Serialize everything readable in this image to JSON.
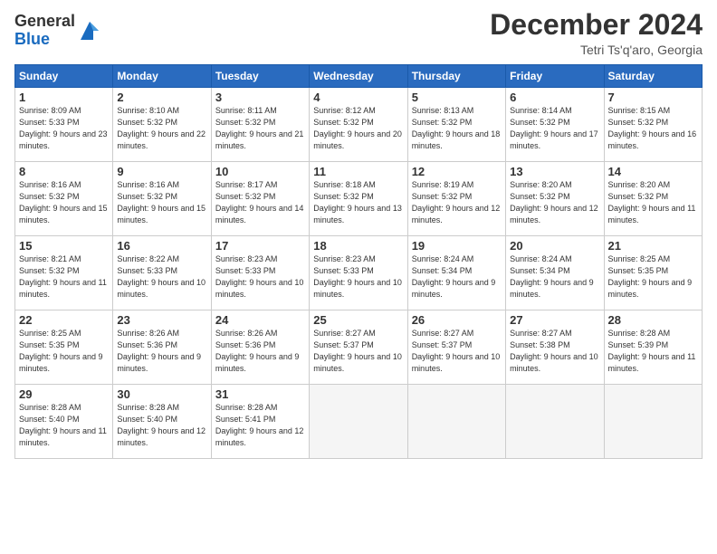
{
  "header": {
    "logo_general": "General",
    "logo_blue": "Blue",
    "month_title": "December 2024",
    "location": "Tetri Ts'q'aro, Georgia"
  },
  "weekdays": [
    "Sunday",
    "Monday",
    "Tuesday",
    "Wednesday",
    "Thursday",
    "Friday",
    "Saturday"
  ],
  "weeks": [
    [
      {
        "day": "1",
        "sunrise": "8:09 AM",
        "sunset": "5:33 PM",
        "daylight": "9 hours and 23 minutes."
      },
      {
        "day": "2",
        "sunrise": "8:10 AM",
        "sunset": "5:32 PM",
        "daylight": "9 hours and 22 minutes."
      },
      {
        "day": "3",
        "sunrise": "8:11 AM",
        "sunset": "5:32 PM",
        "daylight": "9 hours and 21 minutes."
      },
      {
        "day": "4",
        "sunrise": "8:12 AM",
        "sunset": "5:32 PM",
        "daylight": "9 hours and 20 minutes."
      },
      {
        "day": "5",
        "sunrise": "8:13 AM",
        "sunset": "5:32 PM",
        "daylight": "9 hours and 18 minutes."
      },
      {
        "day": "6",
        "sunrise": "8:14 AM",
        "sunset": "5:32 PM",
        "daylight": "9 hours and 17 minutes."
      },
      {
        "day": "7",
        "sunrise": "8:15 AM",
        "sunset": "5:32 PM",
        "daylight": "9 hours and 16 minutes."
      }
    ],
    [
      {
        "day": "8",
        "sunrise": "8:16 AM",
        "sunset": "5:32 PM",
        "daylight": "9 hours and 15 minutes."
      },
      {
        "day": "9",
        "sunrise": "8:16 AM",
        "sunset": "5:32 PM",
        "daylight": "9 hours and 15 minutes."
      },
      {
        "day": "10",
        "sunrise": "8:17 AM",
        "sunset": "5:32 PM",
        "daylight": "9 hours and 14 minutes."
      },
      {
        "day": "11",
        "sunrise": "8:18 AM",
        "sunset": "5:32 PM",
        "daylight": "9 hours and 13 minutes."
      },
      {
        "day": "12",
        "sunrise": "8:19 AM",
        "sunset": "5:32 PM",
        "daylight": "9 hours and 12 minutes."
      },
      {
        "day": "13",
        "sunrise": "8:20 AM",
        "sunset": "5:32 PM",
        "daylight": "9 hours and 12 minutes."
      },
      {
        "day": "14",
        "sunrise": "8:20 AM",
        "sunset": "5:32 PM",
        "daylight": "9 hours and 11 minutes."
      }
    ],
    [
      {
        "day": "15",
        "sunrise": "8:21 AM",
        "sunset": "5:32 PM",
        "daylight": "9 hours and 11 minutes."
      },
      {
        "day": "16",
        "sunrise": "8:22 AM",
        "sunset": "5:33 PM",
        "daylight": "9 hours and 10 minutes."
      },
      {
        "day": "17",
        "sunrise": "8:23 AM",
        "sunset": "5:33 PM",
        "daylight": "9 hours and 10 minutes."
      },
      {
        "day": "18",
        "sunrise": "8:23 AM",
        "sunset": "5:33 PM",
        "daylight": "9 hours and 10 minutes."
      },
      {
        "day": "19",
        "sunrise": "8:24 AM",
        "sunset": "5:34 PM",
        "daylight": "9 hours and 9 minutes."
      },
      {
        "day": "20",
        "sunrise": "8:24 AM",
        "sunset": "5:34 PM",
        "daylight": "9 hours and 9 minutes."
      },
      {
        "day": "21",
        "sunrise": "8:25 AM",
        "sunset": "5:35 PM",
        "daylight": "9 hours and 9 minutes."
      }
    ],
    [
      {
        "day": "22",
        "sunrise": "8:25 AM",
        "sunset": "5:35 PM",
        "daylight": "9 hours and 9 minutes."
      },
      {
        "day": "23",
        "sunrise": "8:26 AM",
        "sunset": "5:36 PM",
        "daylight": "9 hours and 9 minutes."
      },
      {
        "day": "24",
        "sunrise": "8:26 AM",
        "sunset": "5:36 PM",
        "daylight": "9 hours and 9 minutes."
      },
      {
        "day": "25",
        "sunrise": "8:27 AM",
        "sunset": "5:37 PM",
        "daylight": "9 hours and 10 minutes."
      },
      {
        "day": "26",
        "sunrise": "8:27 AM",
        "sunset": "5:37 PM",
        "daylight": "9 hours and 10 minutes."
      },
      {
        "day": "27",
        "sunrise": "8:27 AM",
        "sunset": "5:38 PM",
        "daylight": "9 hours and 10 minutes."
      },
      {
        "day": "28",
        "sunrise": "8:28 AM",
        "sunset": "5:39 PM",
        "daylight": "9 hours and 11 minutes."
      }
    ],
    [
      {
        "day": "29",
        "sunrise": "8:28 AM",
        "sunset": "5:40 PM",
        "daylight": "9 hours and 11 minutes."
      },
      {
        "day": "30",
        "sunrise": "8:28 AM",
        "sunset": "5:40 PM",
        "daylight": "9 hours and 12 minutes."
      },
      {
        "day": "31",
        "sunrise": "8:28 AM",
        "sunset": "5:41 PM",
        "daylight": "9 hours and 12 minutes."
      },
      null,
      null,
      null,
      null
    ]
  ]
}
